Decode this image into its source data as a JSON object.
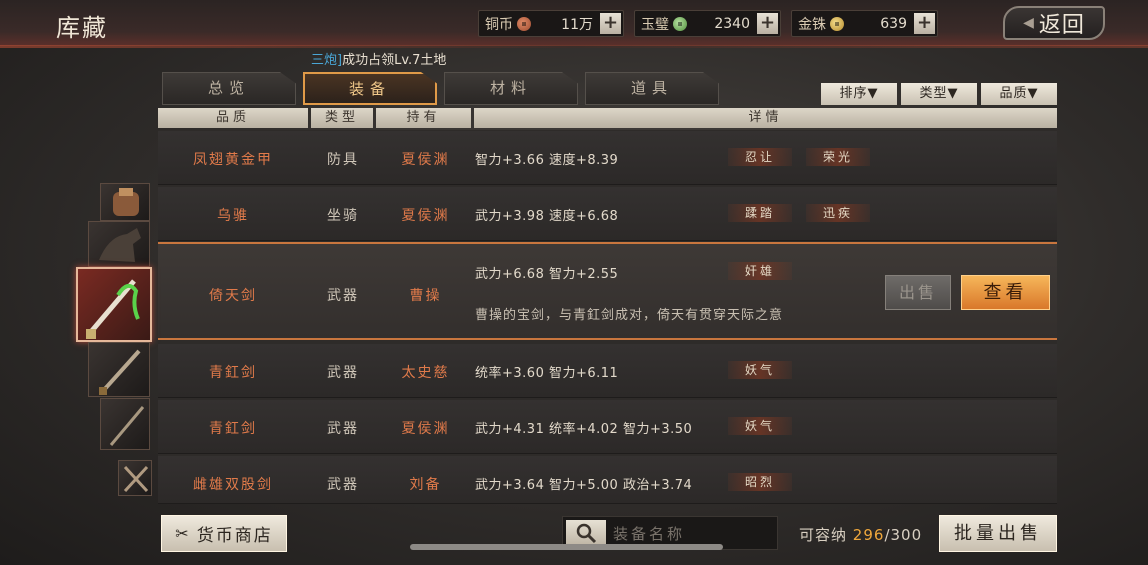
{
  "header": {
    "title": "库藏",
    "back_label": "返回"
  },
  "currencies": [
    {
      "name": "铜币",
      "value": "11万",
      "icon": "copper-coin-icon"
    },
    {
      "name": "玉璧",
      "value": "2340",
      "icon": "jade-coin-icon"
    },
    {
      "name": "金铢",
      "value": "639",
      "icon": "gold-coin-icon"
    }
  ],
  "notice": {
    "highlight": "三炮]",
    "text": "成功占领Lv.7土地"
  },
  "tabs": [
    "总览",
    "装备",
    "材料",
    "道具"
  ],
  "active_tab": "装备",
  "filters": [
    "排序▼",
    "类型▼",
    "品质▼"
  ],
  "columns": [
    "品质",
    "类型",
    "持有",
    "详情"
  ],
  "rows": [
    {
      "name": "凤翅黄金甲",
      "type": "防具",
      "owner": "夏侯渊",
      "attrs": "智力+3.66  速度+8.39",
      "tags": [
        "忍让",
        "荣光"
      ]
    },
    {
      "name": "乌骓",
      "type": "坐骑",
      "owner": "夏侯渊",
      "attrs": "武力+3.98  速度+6.68",
      "tags": [
        "蹂踏",
        "迅疾"
      ]
    },
    {
      "name": "倚天剑",
      "type": "武器",
      "owner": "曹操",
      "attrs": "武力+6.68  智力+2.55",
      "tags": [
        "奸雄"
      ],
      "description": "曹操的宝剑，与青釭剑成对，倚天有贯穿天际之意",
      "selected": true
    },
    {
      "name": "青釭剑",
      "type": "武器",
      "owner": "太史慈",
      "attrs": "统率+3.60  智力+6.11",
      "tags": [
        "妖气"
      ]
    },
    {
      "name": "青釭剑",
      "type": "武器",
      "owner": "夏侯渊",
      "attrs": "武力+4.31  统率+4.02  智力+3.50",
      "tags": [
        "妖气"
      ]
    },
    {
      "name": "雌雄双股剑",
      "type": "武器",
      "owner": "刘备",
      "attrs": "武力+3.64  智力+5.00  政治+3.74",
      "tags": [
        "昭烈"
      ]
    }
  ],
  "actions": {
    "sell": "出售",
    "view": "查看"
  },
  "footer": {
    "shop_label": "货币商店",
    "search_placeholder": "装备名称",
    "capacity_label": "可容纳",
    "capacity_used": "296",
    "capacity_total": "/300",
    "batch_sell_label": "批量出售"
  },
  "colors": {
    "accent": "#e09a48",
    "quality_orange": "#e07a4a",
    "highlight_blue": "#4aa6d6"
  }
}
